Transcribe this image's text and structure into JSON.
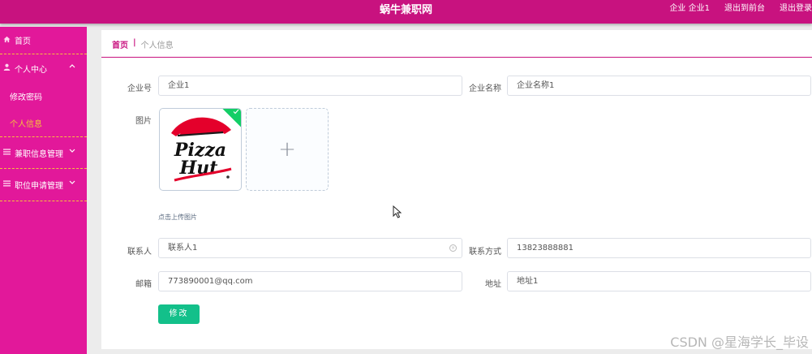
{
  "header": {
    "title": "蜗牛兼职网",
    "user_role": "企业",
    "user_name": "企业1",
    "to_front": "退出到前台",
    "logout": "退出登录"
  },
  "sidebar": {
    "items": [
      {
        "label": "首页",
        "icon": "home-icon"
      },
      {
        "label": "个人中心",
        "icon": "user-icon",
        "expanded": true
      },
      {
        "label": "修改密码"
      },
      {
        "label": "个人信息",
        "active": true
      },
      {
        "label": "兼职信息管理",
        "icon": "menu-icon"
      },
      {
        "label": "职位申请管理",
        "icon": "menu-icon"
      }
    ]
  },
  "breadcrumb": {
    "home": "首页",
    "separator": "|",
    "current": "个人信息"
  },
  "form": {
    "company_no_label": "企业号",
    "company_no_value": "企业1",
    "company_name_label": "企业名称",
    "company_name_value": "企业名称1",
    "image_label": "图片",
    "upload_hint": "点击上传图片",
    "upload_plus": "+",
    "image_logo": "Pizza Hut",
    "contact_label": "联系人",
    "contact_value": "联系人1",
    "phone_label": "联系方式",
    "phone_value": "13823888881",
    "email_label": "邮箱",
    "email_value": "773890001@qq.com",
    "address_label": "地址",
    "address_value": "地址1",
    "submit_label": "修改"
  },
  "watermark": "CSDN @星海学长_毕设",
  "colors": {
    "header_bg": "#c8127f",
    "sidebar_bg": "#e2189a",
    "active_text": "#f6c23b",
    "button_bg": "#13c08a"
  }
}
